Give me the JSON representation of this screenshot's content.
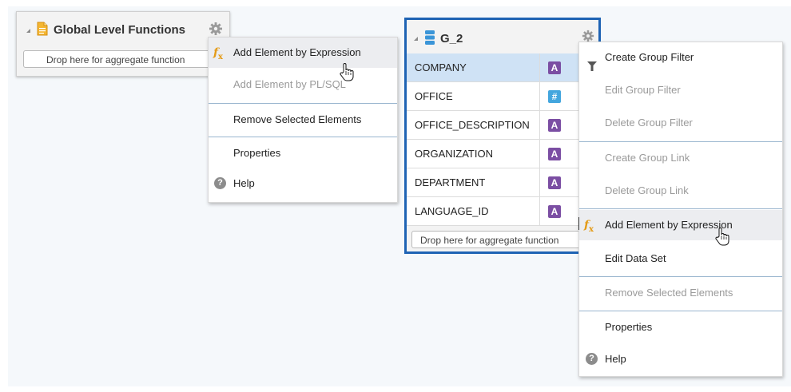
{
  "colors": {
    "accent_border": "#1e63b4",
    "fx_icon": "#e49b16",
    "type_text_badge": "#7b4ea3",
    "type_number_badge": "#43a6de",
    "selected_row": "#cfe2f5",
    "hover_item": "#ecedf0",
    "disabled_text": "#9a9a9a"
  },
  "global_panel": {
    "title": "Global Level Functions",
    "icons": [
      "collapse-triangle-icon",
      "document-icon",
      "gear-icon"
    ],
    "drop_placeholder": "Drop here for aggregate function"
  },
  "global_menu": {
    "items": [
      {
        "label": "Add Element by Expression",
        "icon": "fx-icon",
        "state": "hover"
      },
      {
        "label": "Add Element by PL/SQL",
        "state": "disabled"
      },
      {
        "label": "Remove Selected Elements",
        "state": "enabled"
      },
      {
        "label": "Properties",
        "state": "enabled"
      },
      {
        "label": "Help",
        "icon": "help-icon",
        "state": "enabled"
      }
    ]
  },
  "g2_panel": {
    "title": "G_2",
    "icons": [
      "collapse-triangle-icon",
      "data-group-icon",
      "gear-icon"
    ],
    "rows": [
      {
        "name": "COMPANY",
        "type": "A",
        "selected": true
      },
      {
        "name": "OFFICE",
        "type": "#",
        "selected": false
      },
      {
        "name": "OFFICE_DESCRIPTION",
        "type": "A",
        "selected": false
      },
      {
        "name": "ORGANIZATION",
        "type": "A",
        "selected": false
      },
      {
        "name": "DEPARTMENT",
        "type": "A",
        "selected": false
      },
      {
        "name": "LANGUAGE_ID",
        "type": "A",
        "selected": false
      }
    ],
    "drop_placeholder": "Drop here for aggregate function"
  },
  "g2_menu": {
    "items": [
      {
        "label": "Create Group Filter",
        "icon": "filter-icon",
        "state": "enabled"
      },
      {
        "label": "Edit Group Filter",
        "state": "disabled"
      },
      {
        "label": "Delete Group Filter",
        "state": "disabled"
      },
      {
        "label": "Create Group Link",
        "state": "disabled"
      },
      {
        "label": "Delete Group Link",
        "state": "disabled"
      },
      {
        "label": "Add Element by Expression",
        "icon": "fx-icon",
        "state": "hover"
      },
      {
        "label": "Edit Data Set",
        "state": "enabled"
      },
      {
        "label": "Remove Selected Elements",
        "state": "disabled"
      },
      {
        "label": "Properties",
        "state": "enabled"
      },
      {
        "label": "Help",
        "icon": "help-icon",
        "state": "enabled"
      }
    ]
  }
}
